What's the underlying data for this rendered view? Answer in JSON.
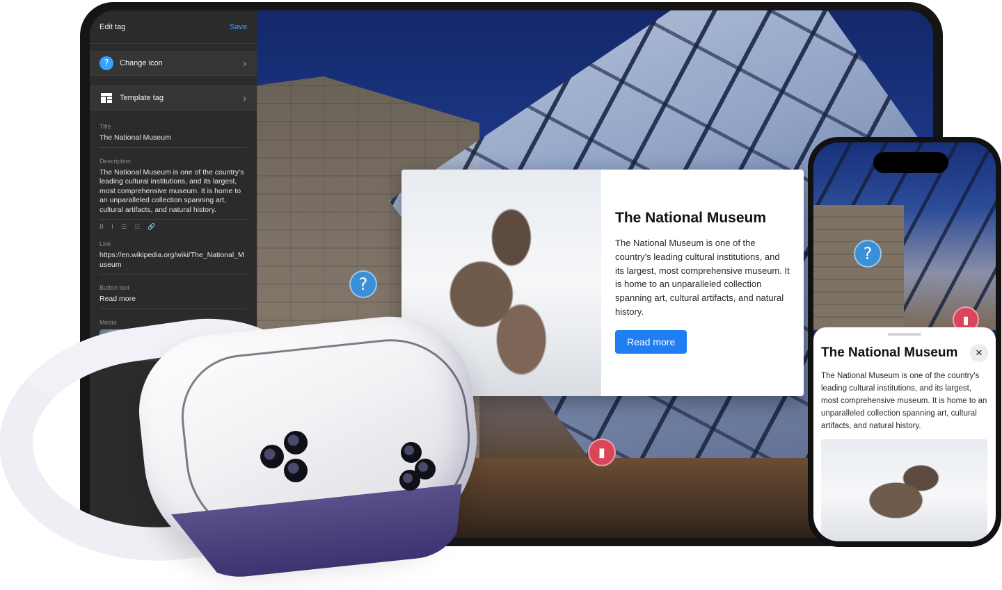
{
  "editor": {
    "header_title": "Edit tag",
    "save_label": "Save",
    "change_icon_label": "Change icon",
    "template_tag_label": "Template tag",
    "title_label": "Title",
    "title_value": "The National Museum",
    "description_label": "Description",
    "description_value": "The National Museum is one of the country's leading cultural institutions, and its largest, most comprehensive museum. It is home to an unparalleled collection spanning art, cultural artifacts, and natural history.",
    "format_buttons": [
      "B",
      "I",
      "☰",
      "☷",
      "🔗"
    ],
    "link_label": "Link",
    "link_value": "https://en.wikipedia.org/wiki/The_National_Museum",
    "button_text_label": "Button text",
    "button_text_value": "Read more",
    "media_label": "Media"
  },
  "popup": {
    "title": "The National Museum",
    "description": "The National Museum is one of the country's leading cultural institutions, and its largest, most comprehensive museum. It is home to an unparalleled collection spanning art, cultural artifacts, and natural history.",
    "button_label": "Read more"
  },
  "phone": {
    "title": "The National Museum",
    "description": "The National Museum is one of the country's leading cultural institutions, and its largest, most comprehensive museum. It is home to an unparalleled collection spanning art, cultural artifacts, and natural history."
  },
  "icons": {
    "info_hotspot": "question-mark-icon",
    "door_hotspot": "door-icon",
    "template": "layout-grid-icon",
    "upload": "upload-icon",
    "close": "close-icon"
  },
  "colors": {
    "accent": "#1f7ef2",
    "save": "#4a9eff",
    "info_hotspot": "#3b8fd6",
    "door_hotspot": "#d9465a",
    "editor_bg": "#2b2b2b"
  }
}
